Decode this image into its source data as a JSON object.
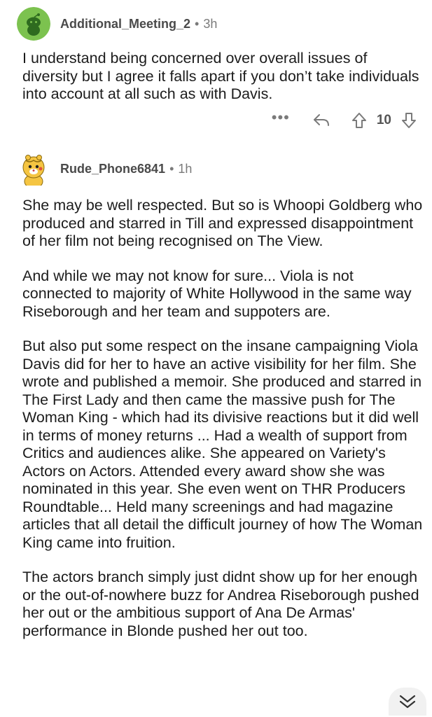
{
  "comment1": {
    "username": "Additional_Meeting_2",
    "separator": "•",
    "age": "3h",
    "body": "I understand being concerned over overall issues of diversity but I agree it falls apart if you don’t take individuals into account at all such as with Davis.",
    "more_label": "•••",
    "score": "10",
    "avatar_color": "#6fbf4a"
  },
  "comment2": {
    "username": "Rude_Phone6841",
    "separator": "•",
    "age": "1h",
    "paragraphs": [
      "She may be well respected. But so is Whoopi Goldberg who produced and starred in Till and expressed disappointment of her film not being recognised on The View.",
      "And while we may not know for sure... Viola is not connected to majority of White Hollywood in the same way Riseborough and her team and suppoters are.",
      "But also put some respect on the insane campaigning Viola Davis did for her to have an active visibility for her film. She wrote and published a memoir.  She produced and starred in The First Lady and then came the massive push for The Woman King - which had its divisive reactions but it did well in terms of money returns ... Had a wealth of support from Critics and audiences alike. She appeared on Variety's Actors on Actors. Attended every award show she was nominated in this year. She even went on THR Producers Roundtable... Held many screenings and had magazine articles that all detail the difficult journey of how The Woman King came into fruition.",
      "The actors branch simply just didnt show up for her enough or the out-of-nowhere buzz for Andrea Riseborough pushed her out or the ambitious support of Ana De Armas' performance in Blonde pushed her out too."
    ],
    "avatar_color": "#f5c542"
  },
  "icons": {
    "reply": "reply-arrow-icon",
    "upvote": "upvote-arrow-icon",
    "downvote": "downvote-arrow-icon",
    "scroll_down": "double-chevron-down-icon"
  }
}
